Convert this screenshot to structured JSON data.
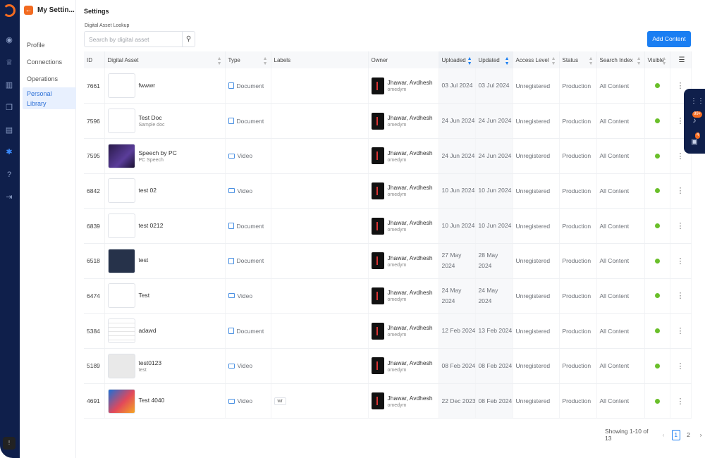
{
  "panel": {
    "title": "My Settin...",
    "nav": [
      "Profile",
      "Connections",
      "Operations",
      "Personal Library"
    ]
  },
  "main": {
    "title": "Settings",
    "lookup_label": "Digital Asset Lookup",
    "search_placeholder": "Search by digital asset",
    "add_button": "Add Content"
  },
  "columns": [
    "ID",
    "Digital Asset",
    "Type",
    "Labels",
    "Owner",
    "Uploaded",
    "Updated",
    "Access Level",
    "Status",
    "Search Index",
    "Visible"
  ],
  "rows": [
    {
      "id": "7661",
      "name": "fwwwr",
      "sub": "",
      "type": "Document",
      "label": "",
      "owner": "Jhawar, Avdhesh",
      "handle": "omedym",
      "uploaded": "03 Jul 2024",
      "updated": "03 Jul 2024",
      "access": "Unregistered",
      "status": "Production",
      "index": "All Content"
    },
    {
      "id": "7596",
      "name": "Test Doc",
      "sub": "Sample doc",
      "type": "Document",
      "label": "",
      "owner": "Jhawar, Avdhesh",
      "handle": "omedym",
      "uploaded": "24 Jun 2024",
      "updated": "24 Jun 2024",
      "access": "Unregistered",
      "status": "Production",
      "index": "All Content"
    },
    {
      "id": "7595",
      "name": "Speech by PC",
      "sub": "PC Speech",
      "type": "Video",
      "label": "",
      "owner": "Jhawar, Avdhesh",
      "handle": "omedym",
      "uploaded": "24 Jun 2024",
      "updated": "24 Jun 2024",
      "access": "Unregistered",
      "status": "Production",
      "index": "All Content"
    },
    {
      "id": "6842",
      "name": "test 02",
      "sub": "",
      "type": "Video",
      "label": "",
      "owner": "Jhawar, Avdhesh",
      "handle": "omedym",
      "uploaded": "10 Jun 2024",
      "updated": "10 Jun 2024",
      "access": "Unregistered",
      "status": "Production",
      "index": "All Content"
    },
    {
      "id": "6839",
      "name": "test 0212",
      "sub": "",
      "type": "Document",
      "label": "",
      "owner": "Jhawar, Avdhesh",
      "handle": "omedym",
      "uploaded": "10 Jun 2024",
      "updated": "10 Jun 2024",
      "access": "Unregistered",
      "status": "Production",
      "index": "All Content"
    },
    {
      "id": "6518",
      "name": "test",
      "sub": "",
      "type": "Document",
      "label": "",
      "owner": "Jhawar, Avdhesh",
      "handle": "omedym",
      "uploaded": "27 May 2024",
      "updated": "28 May 2024",
      "access": "Unregistered",
      "status": "Production",
      "index": "All Content"
    },
    {
      "id": "6474",
      "name": "Test",
      "sub": "",
      "type": "Video",
      "label": "",
      "owner": "Jhawar, Avdhesh",
      "handle": "omedym",
      "uploaded": "24 May 2024",
      "updated": "24 May 2024",
      "access": "Unregistered",
      "status": "Production",
      "index": "All Content"
    },
    {
      "id": "5384",
      "name": "adawd",
      "sub": "",
      "type": "Document",
      "label": "",
      "owner": "Jhawar, Avdhesh",
      "handle": "omedym",
      "uploaded": "12 Feb 2024",
      "updated": "13 Feb 2024",
      "access": "Unregistered",
      "status": "Production",
      "index": "All Content"
    },
    {
      "id": "5189",
      "name": "test0123",
      "sub": "test",
      "type": "Video",
      "label": "",
      "owner": "Jhawar, Avdhesh",
      "handle": "omedym",
      "uploaded": "08 Feb 2024",
      "updated": "08 Feb 2024",
      "access": "Unregistered",
      "status": "Production",
      "index": "All Content"
    },
    {
      "id": "4691",
      "name": "Test 4040",
      "sub": "",
      "type": "Video",
      "label": "wr",
      "owner": "Jhawar, Avdhesh",
      "handle": "omedym",
      "uploaded": "22 Dec 2023",
      "updated": "08 Feb 2024",
      "access": "Unregistered",
      "status": "Production",
      "index": "All Content"
    }
  ],
  "thumb_styles": [
    "blank",
    "blank",
    "dark",
    "blank",
    "blank",
    "slide",
    "blank",
    "doc",
    "grey",
    "colorful"
  ],
  "visible_color": "#6abf2a",
  "pagination": {
    "summary": "Showing 1-10 of 13",
    "pages": [
      "1",
      "2"
    ],
    "current": "1"
  },
  "float": {
    "badge_top": "99+",
    "badge_bottom": "4"
  },
  "colors": {
    "accent": "#1a7ef2",
    "brand": "#f26b21",
    "rail": "#0f1f4b"
  }
}
